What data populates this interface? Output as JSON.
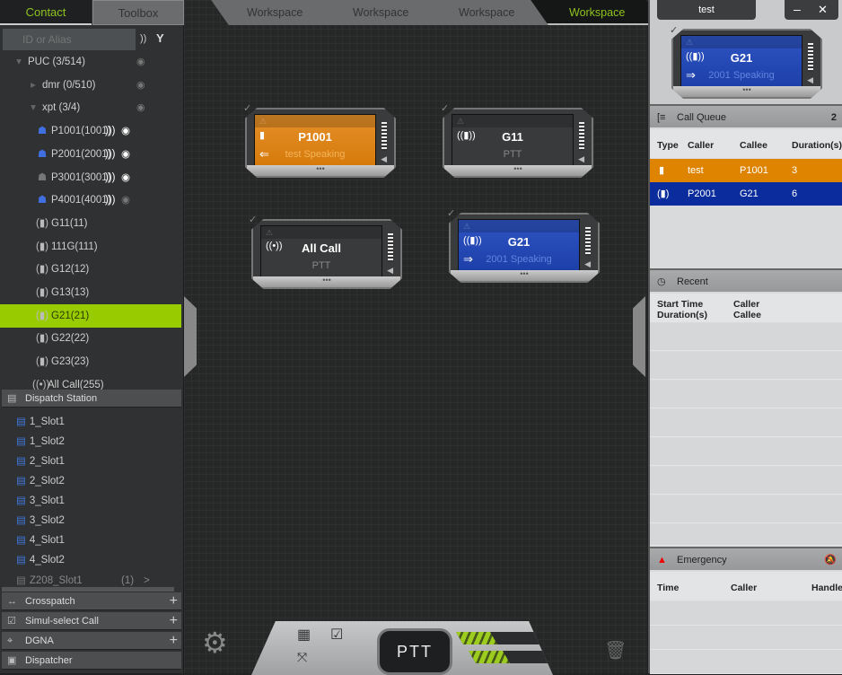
{
  "left": {
    "tabs": {
      "contact": "Contact",
      "toolbox": "Toolbox"
    },
    "search": {
      "placeholder": "ID or Alias"
    },
    "tree": [
      {
        "label": "PUC (3/514)",
        "icon": "triangle-down-icon"
      },
      {
        "label": "dmr (0/510)",
        "icon": "triangle-right-icon"
      },
      {
        "label": "xpt (3/4)",
        "icon": "triangle-down-icon"
      },
      {
        "label": "P1001(1001)",
        "icon": "user-radio-icon"
      },
      {
        "label": "P2001(2001)",
        "icon": "user-radio-icon"
      },
      {
        "label": "P3001(3001)",
        "icon": "user-offline-icon"
      },
      {
        "label": "P4001(4001)",
        "icon": "user-police-icon"
      },
      {
        "label": "G11(11)",
        "icon": "group-icon"
      },
      {
        "label": "111G(111)",
        "icon": "group-icon"
      },
      {
        "label": "G12(12)",
        "icon": "group-icon"
      },
      {
        "label": "G13(13)",
        "icon": "group-icon"
      },
      {
        "label": "G21(21)",
        "icon": "group-icon",
        "selected": true
      },
      {
        "label": "G22(22)",
        "icon": "group-icon"
      },
      {
        "label": "G23(23)",
        "icon": "group-icon"
      },
      {
        "label": "All Call(255)",
        "icon": "broadcast-icon"
      }
    ],
    "dispatch_station": {
      "title": "Dispatch Station",
      "slots": [
        "1_Slot1",
        "1_Slot2",
        "2_Slot1",
        "2_Slot2",
        "3_Slot1",
        "3_Slot2",
        "4_Slot1",
        "4_Slot2"
      ],
      "partial_slot": {
        "label": "Z208_Slot1",
        "count": "(1)"
      }
    },
    "sections": [
      "Crosspatch",
      "Simul-select Call",
      "DGNA",
      "Dispatcher"
    ]
  },
  "workspace_tabs": [
    "Workspace",
    "Workspace",
    "Workspace",
    "Workspace"
  ],
  "cards": [
    {
      "name": "P1001",
      "status": "test Speaking",
      "color": "#d67a0b"
    },
    {
      "name": "G11",
      "status": "PTT"
    },
    {
      "name": "All Call",
      "status": "PTT"
    },
    {
      "name": "G21",
      "status": "2001 Speaking",
      "color": "#1d3fa8"
    }
  ],
  "bottom": {
    "ptt": "PTT",
    "level_1": 0.4,
    "level_2": 0.4
  },
  "right": {
    "user": "test",
    "minimize": "–",
    "close": "✕",
    "selected_card": {
      "name": "G21",
      "status": "2001 Speaking"
    },
    "call_queue": {
      "title": "Call Queue",
      "count": "2",
      "columns": [
        "Type",
        "Caller",
        "Callee",
        "Duration(s)"
      ],
      "rows": [
        {
          "caller": "test",
          "callee": "P1001",
          "duration": "3",
          "color": "#de8400"
        },
        {
          "caller": "P2001",
          "callee": "G21",
          "duration": "6",
          "color": "#0a2c9c"
        }
      ]
    },
    "recent": {
      "title": "Recent",
      "columns": [
        "Start Time",
        "Duration(s)",
        "Caller",
        "Callee"
      ]
    },
    "emergency": {
      "title": "Emergency",
      "columns": [
        "Time",
        "Caller",
        "Handle"
      ]
    }
  }
}
